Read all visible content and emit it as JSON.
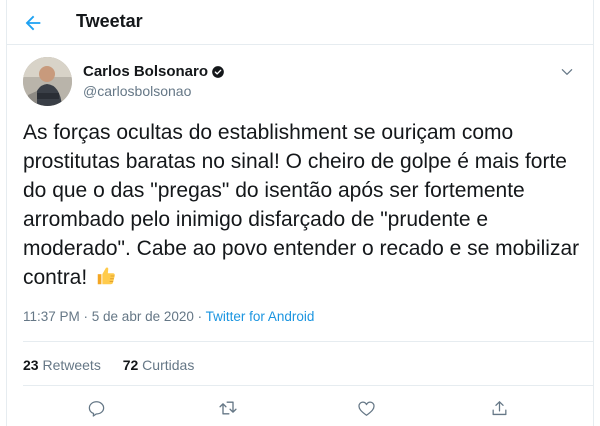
{
  "header": {
    "title": "Tweetar",
    "back_icon": "arrow-left-icon"
  },
  "tweet": {
    "author_name": "Carlos Bolsonaro",
    "author_handle": "@carlosbolsonao",
    "text": "As forças ocultas do establishment se ouriçam como prostitutas baratas no sinal! O cheiro de golpe é mais forte do que o das \"pregas\" do isentão após ser fortemente arrombado pelo inimigo disfarçado de \"prudente e moderado\". Cabe ao povo entender o recado e se mobilizar contra!",
    "emoji": "thumbs-up",
    "time": "11:37 PM · 5 de abr de 2020 · ",
    "source": "Twitter for Android"
  },
  "stats": {
    "retweets_count": "23",
    "retweets_label": " Retweets",
    "likes_count": "72",
    "likes_label": " Curtidas"
  },
  "actions": [
    "reply-icon",
    "retweet-icon",
    "like-icon",
    "share-icon"
  ],
  "colors": {
    "accent": "#1da1f2",
    "text": "#14171a",
    "secondary": "#657786",
    "border": "#e6ecf0"
  }
}
